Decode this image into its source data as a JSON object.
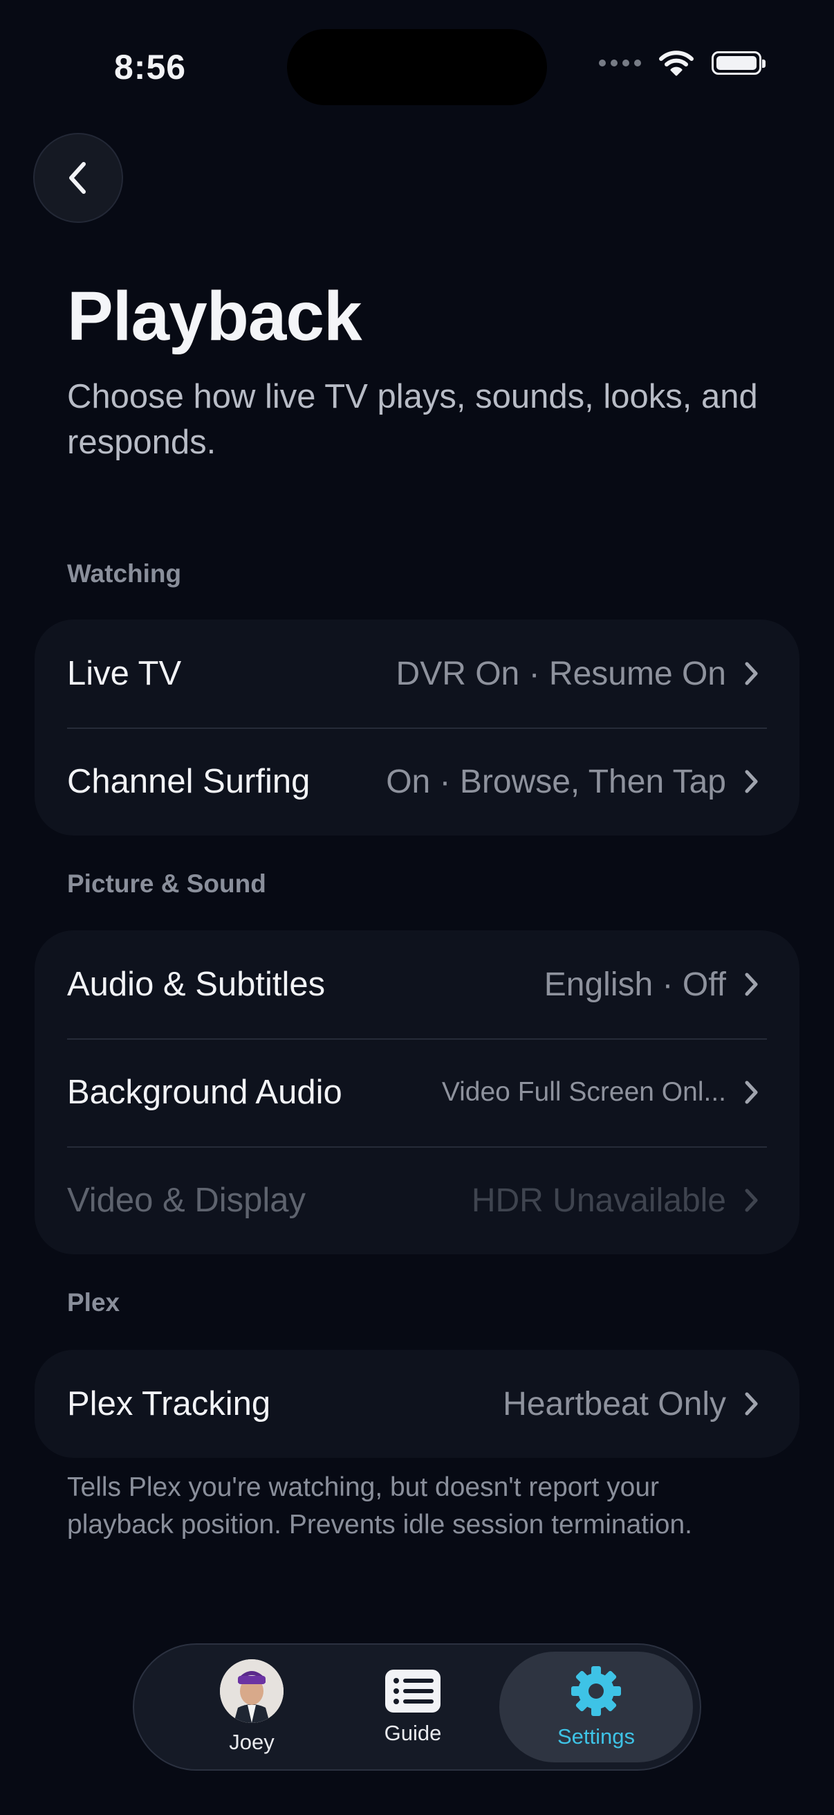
{
  "status": {
    "time": "8:56"
  },
  "header": {
    "title": "Playback",
    "subtitle": "Choose how live TV plays, sounds, looks, and responds."
  },
  "sections": [
    {
      "label": "Watching",
      "rows": [
        {
          "label": "Live TV",
          "value": "DVR On · Resume On"
        },
        {
          "label": "Channel Surfing",
          "value": "On · Browse, Then Tap"
        }
      ]
    },
    {
      "label": "Picture & Sound",
      "rows": [
        {
          "label": "Audio & Subtitles",
          "value": "English · Off"
        },
        {
          "label": "Background Audio",
          "value": "Video Full Screen Onl..."
        },
        {
          "label": "Video & Display",
          "value": "HDR Unavailable",
          "disabled": true
        }
      ]
    },
    {
      "label": "Plex",
      "rows": [
        {
          "label": "Plex Tracking",
          "value": "Heartbeat Only"
        }
      ]
    }
  ],
  "footnote": "Tells Plex you're watching, but doesn't report your playback position. Prevents idle session termination.",
  "tabbar": {
    "tabs": [
      {
        "label": "Joey",
        "icon": "avatar"
      },
      {
        "label": "Guide",
        "icon": "guide-list-icon"
      },
      {
        "label": "Settings",
        "icon": "gear-icon",
        "active": true
      }
    ]
  },
  "colors": {
    "background": "#070a14",
    "card": "#0e121d",
    "accent": "#3ec3e6"
  }
}
